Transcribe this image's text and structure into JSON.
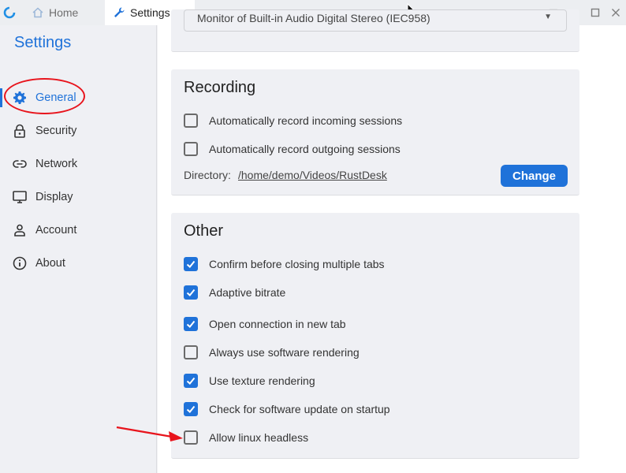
{
  "titlebar": {
    "tabs": [
      {
        "label": "Home",
        "icon": "home-icon"
      },
      {
        "label": "Settings",
        "icon": "wrench-icon"
      }
    ],
    "controls": [
      "menu-icon",
      "minimize-icon",
      "maximize-icon",
      "close-icon"
    ]
  },
  "sidebar": {
    "title": "Settings",
    "items": [
      {
        "label": "General",
        "icon": "gear-icon",
        "active": true
      },
      {
        "label": "Security",
        "icon": "lock-icon"
      },
      {
        "label": "Network",
        "icon": "link-icon"
      },
      {
        "label": "Display",
        "icon": "monitor-icon"
      },
      {
        "label": "Account",
        "icon": "person-icon"
      },
      {
        "label": "About",
        "icon": "info-icon"
      }
    ]
  },
  "audio": {
    "selected": "Monitor of Built-in Audio Digital Stereo (IEC958)"
  },
  "recording": {
    "title": "Recording",
    "options": [
      {
        "label": "Automatically record incoming sessions",
        "checked": false
      },
      {
        "label": "Automatically record outgoing sessions",
        "checked": false
      }
    ],
    "directory_label": "Directory:",
    "directory_path": "/home/demo/Videos/RustDesk",
    "change_label": "Change"
  },
  "other": {
    "title": "Other",
    "options": [
      {
        "label": "Confirm before closing multiple tabs",
        "checked": true
      },
      {
        "label": "Adaptive bitrate",
        "checked": true
      },
      {
        "label": "Open connection in new tab",
        "checked": true
      },
      {
        "label": "Always use software rendering",
        "checked": false
      },
      {
        "label": "Use texture rendering",
        "checked": true
      },
      {
        "label": "Check for software update on startup",
        "checked": true
      },
      {
        "label": "Allow linux headless",
        "checked": false
      }
    ]
  },
  "colors": {
    "accent": "#1f72d9",
    "annotation": "#e8141c"
  }
}
